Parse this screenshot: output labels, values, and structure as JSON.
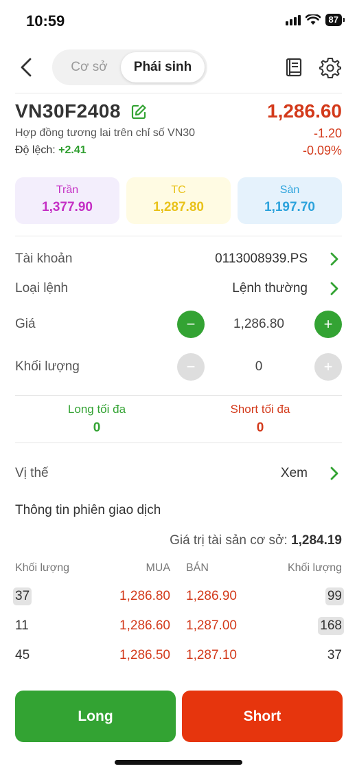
{
  "status_bar": {
    "time": "10:59",
    "battery": "87"
  },
  "header": {
    "tabs": [
      {
        "label": "Cơ sở",
        "active": false
      },
      {
        "label": "Phái sinh",
        "active": true
      }
    ]
  },
  "contract": {
    "symbol": "VN30F2408",
    "description": "Hợp đồng tương lai trên chỉ số VN30",
    "deviation_label": "Độ lệch:",
    "deviation_value": "+2.41",
    "price": "1,286.60",
    "change": "-1.20",
    "change_pct": "-0.09%"
  },
  "ref_prices": {
    "ceiling_label": "Trần",
    "ceiling_value": "1,377.90",
    "reference_label": "TC",
    "reference_value": "1,287.80",
    "floor_label": "Sàn",
    "floor_value": "1,197.70"
  },
  "form": {
    "account_label": "Tài khoản",
    "account_value": "0113008939.PS",
    "order_type_label": "Loại lệnh",
    "order_type_value": "Lệnh thường",
    "price_label": "Giá",
    "price_value": "1,286.80",
    "volume_label": "Khối lượng",
    "volume_value": "0",
    "minus": "−",
    "plus": "+"
  },
  "max": {
    "long_label": "Long tối đa",
    "long_value": "0",
    "short_label": "Short tối đa",
    "short_value": "0"
  },
  "position": {
    "label": "Vị thế",
    "value": "Xem"
  },
  "session": {
    "title": "Thông tin phiên giao dịch",
    "asset_label": "Giá trị tài sản cơ sở:",
    "asset_value": "1,284.19",
    "headers": {
      "bid_vol": "Khối lượng",
      "bid": "MUA",
      "ask": "BÁN",
      "ask_vol": "Khối lượng"
    },
    "rows": [
      {
        "bid_vol": "37",
        "bid": "1,286.80",
        "ask": "1,286.90",
        "ask_vol": "99"
      },
      {
        "bid_vol": "11",
        "bid": "1,286.60",
        "ask": "1,287.00",
        "ask_vol": "168"
      },
      {
        "bid_vol": "45",
        "bid": "1,286.50",
        "ask": "1,287.10",
        "ask_vol": "37"
      }
    ]
  },
  "actions": {
    "long": "Long",
    "short": "Short"
  },
  "colors": {
    "green": "#33a333",
    "red": "#e6350d",
    "price_red": "#d33a1b"
  }
}
